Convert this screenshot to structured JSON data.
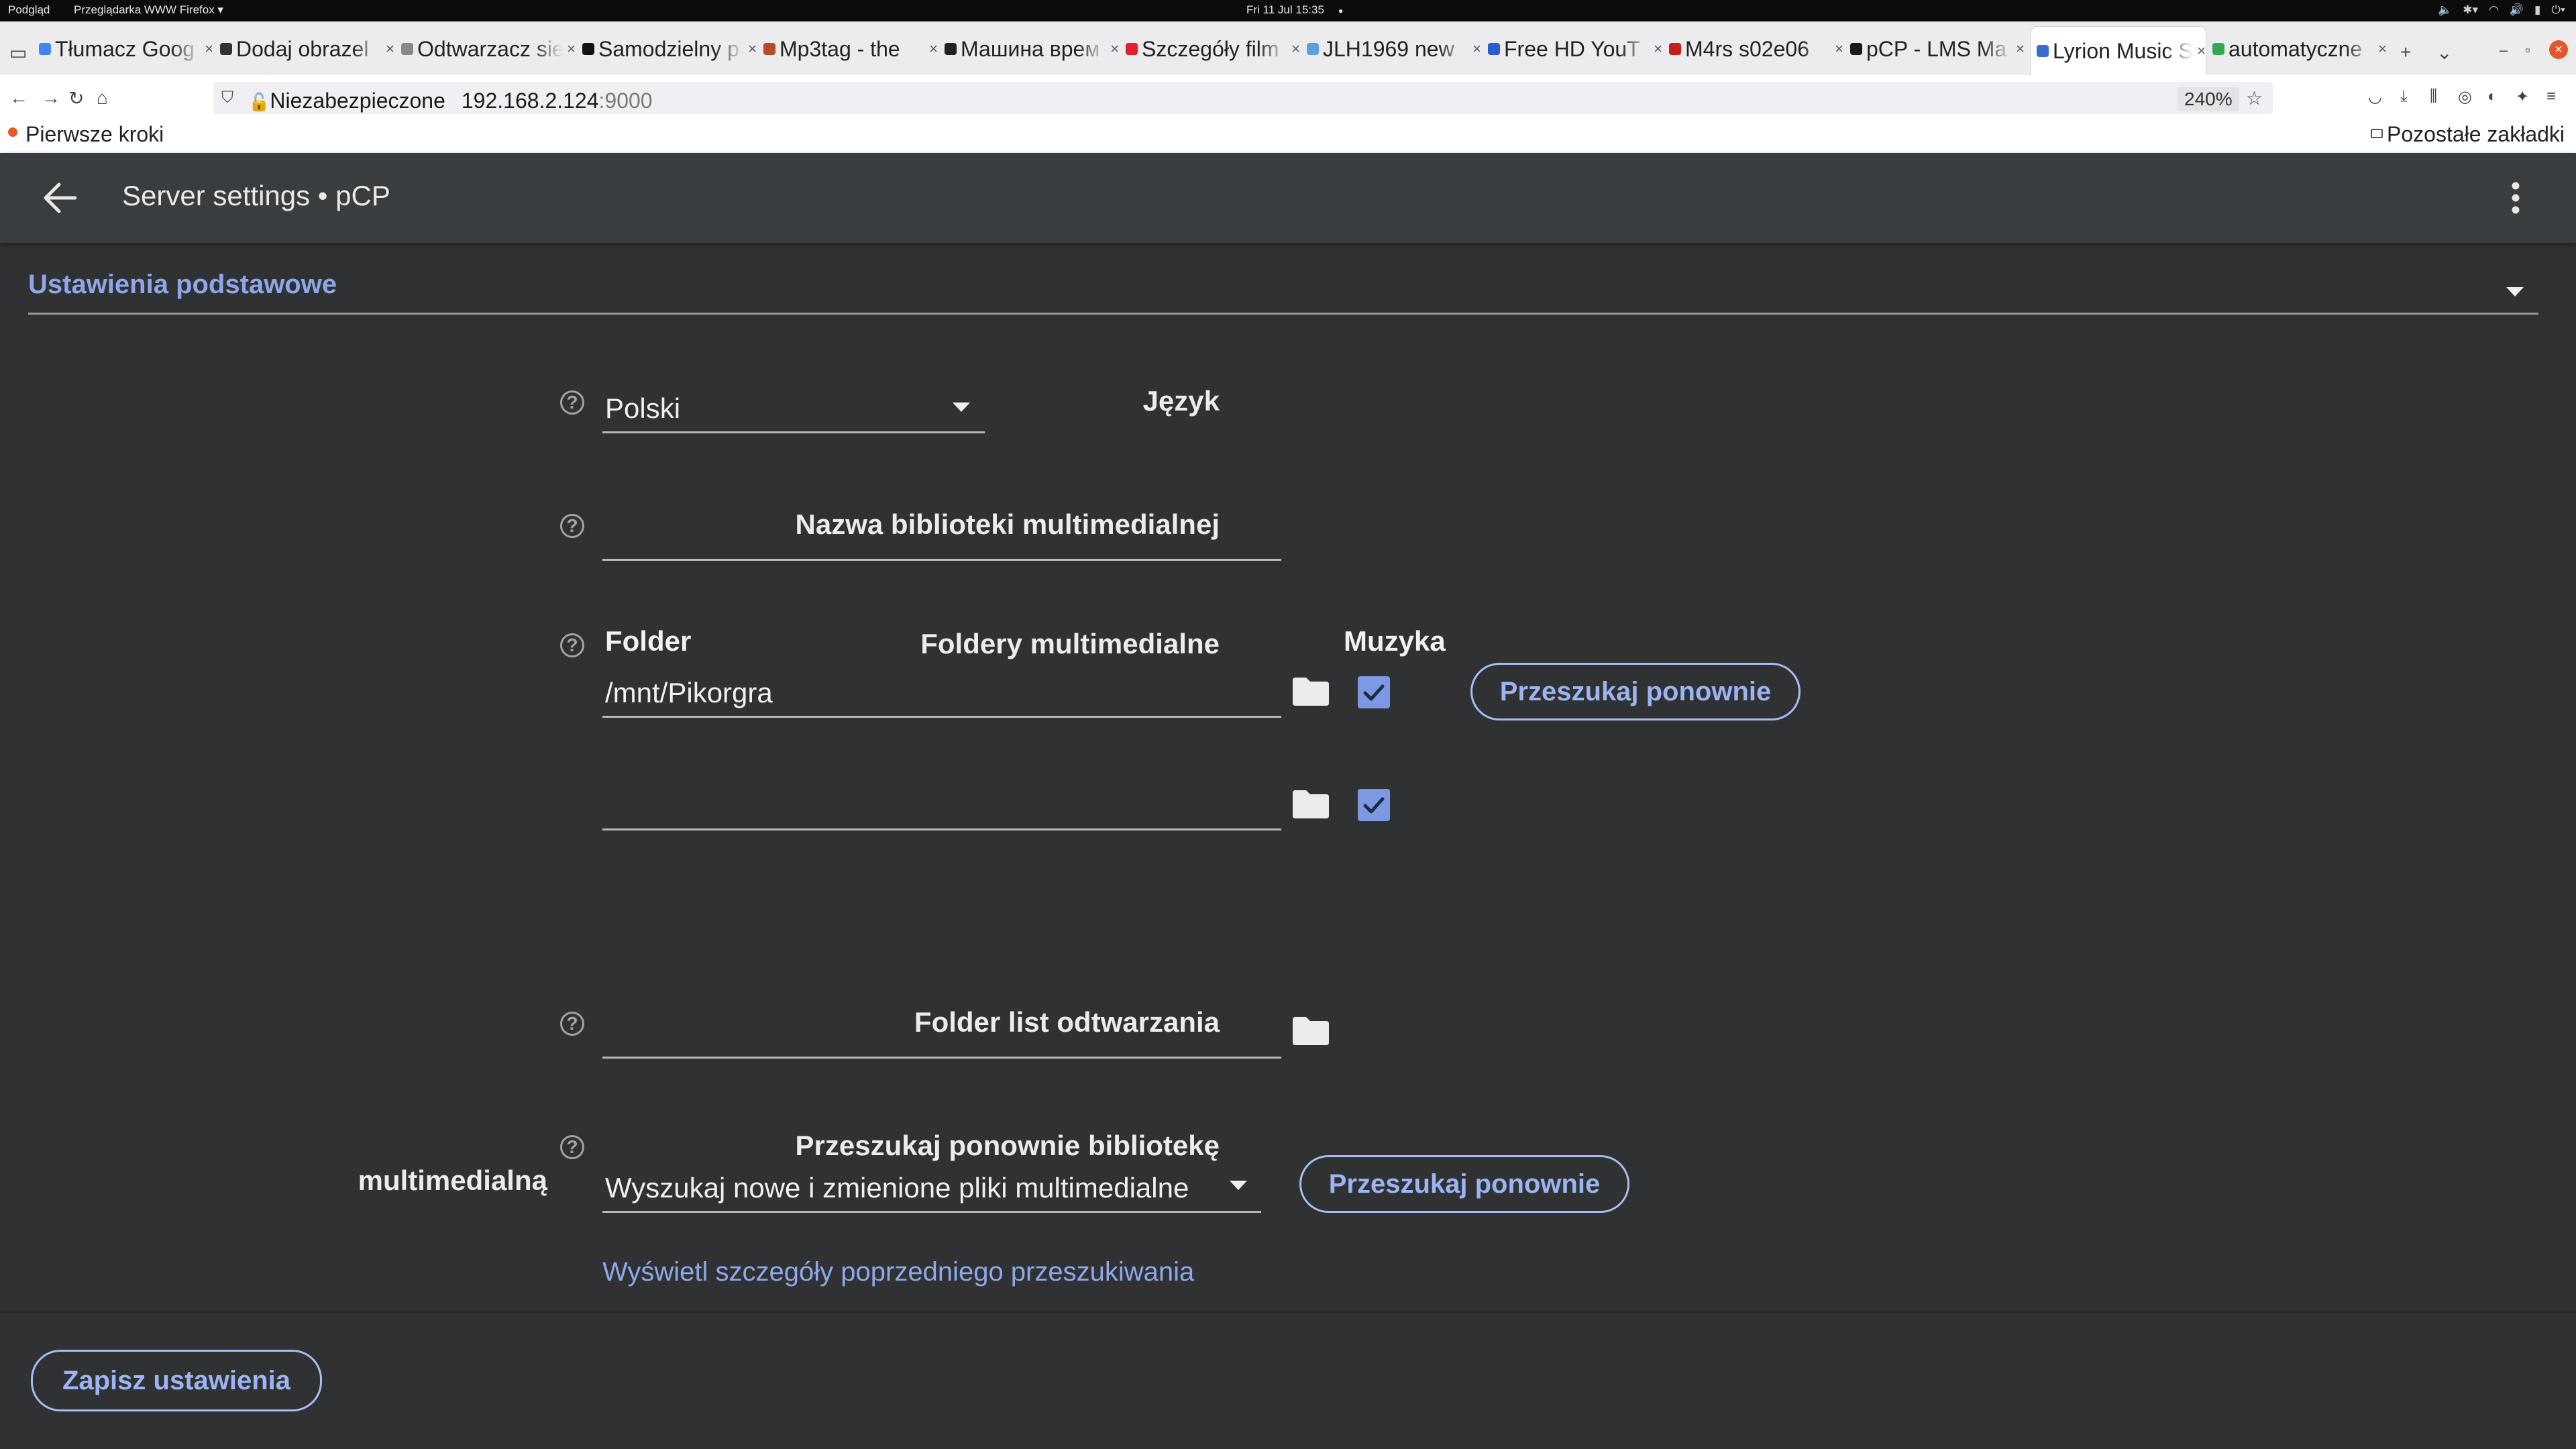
{
  "os": {
    "app": "Podgląd",
    "browser_menu": "Przeglądarka WWW Firefox ▾",
    "clock": "Fri 11 Jul  15:35",
    "dot": "●"
  },
  "tabs": [
    {
      "title": "Tłumacz Goog",
      "color": "#4285f4"
    },
    {
      "title": "Dodaj obrazel",
      "color": "#333333"
    },
    {
      "title": "Odtwarzacz sie",
      "color": "#888888"
    },
    {
      "title": "Samodzielny p",
      "color": "#111111"
    },
    {
      "title": "Mp3tag - the",
      "color": "#b84a2c"
    },
    {
      "title": "Машина врем",
      "color": "#222222"
    },
    {
      "title": "Szczegóły film",
      "color": "#e0202a"
    },
    {
      "title": "JLH1969 new",
      "color": "#5aa0e0"
    },
    {
      "title": "Free HD YouT",
      "color": "#2a5cd1"
    },
    {
      "title": "M4rs s02e06",
      "color": "#c81d1d"
    },
    {
      "title": "pCP - LMS Ma",
      "color": "#1a1a1a"
    },
    {
      "title": "Lyrion Music S",
      "color": "#3a6cd0"
    },
    {
      "title": "automatyczne",
      "color": "#34a853"
    }
  ],
  "active_tab_index": 11,
  "nav": {
    "insecure_label": "Niezabezpieczone",
    "url_host": "192.168.2.124",
    "url_port": ":9000",
    "zoom": "240%"
  },
  "bookmarks": {
    "first": "Pierwsze kroki",
    "other": "Pozostałe zakładki"
  },
  "app": {
    "title": "Server settings • pCP"
  },
  "section": {
    "title": "Ustawienia podstawowe"
  },
  "form": {
    "language": {
      "label": "Język",
      "value": "Polski"
    },
    "library_name": {
      "label": "Nazwa biblioteki multimedialnej",
      "value": ""
    },
    "media_folders": {
      "label": "Foldery multimedialne",
      "col_folder": "Folder",
      "col_music": "Muzyka",
      "rows": [
        {
          "path": "/mnt/Pikorgra",
          "music": true
        },
        {
          "path": "",
          "music": true
        }
      ],
      "rescan_button": "Przeszukaj ponownie"
    },
    "playlist_folder": {
      "label": "Folder list odtwarzania",
      "value": ""
    },
    "rescan": {
      "label_line1": "Przeszukaj ponownie bibliotekę",
      "label_line2": "multimedialną",
      "mode": "Wyszukaj nowe i zmienione pliki multimedialne",
      "button": "Przeszukaj ponownie",
      "details_link": "Wyświetl szczegóły poprzedniego przeszukiwania"
    },
    "save_button": "Zapisz ustawienia"
  },
  "colors": {
    "accent": "#8ea7e8",
    "background": "#2f3133",
    "header": "#3a3d3f",
    "checkbox": "#7b9ae3"
  }
}
